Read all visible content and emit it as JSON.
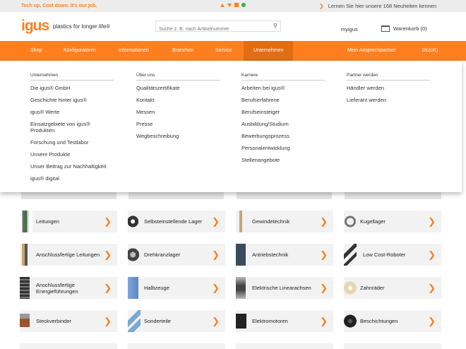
{
  "topbar": {
    "slogan": "Tech up, Cost down. It's our job.",
    "news_text": "Lernen Sie hier unsere 168 Neuheiten kennen",
    "colors": {
      "accent": "#ff7f1e",
      "green": "#2eb34a"
    }
  },
  "header": {
    "logo": "igus",
    "tagline": "plastics for longer life®",
    "search_placeholder": "Suche z. B. nach Artikelnummer",
    "myigus": "myigus",
    "cart": "Warenkorb (0)"
  },
  "nav": {
    "items": [
      "Shop",
      "Konfiguratoren",
      "Informationen",
      "Branchen",
      "Service",
      "Unternehmen"
    ],
    "contact": "Mein Ansprechpartner",
    "lang": "DE(DE)"
  },
  "dropdown": {
    "columns": [
      {
        "heading": "Unternehmen",
        "items": [
          "Die igus® GmbH",
          "Geschichte hinter igus®",
          "igus® Werte",
          "Einsatzgebiete von igus® Produkten",
          "Forschung und Testlabor",
          "Unsere Produkte",
          "Unser Beitrag zur Nachhaltigkeit",
          "igus® digital"
        ]
      },
      {
        "heading": "Über uns",
        "items": [
          "Qualitätszertifikate",
          "Kontakt",
          "Messen",
          "Presse",
          "Wegbeschreibung"
        ]
      },
      {
        "heading": "Karriere",
        "items": [
          "Arbeiten bei igus®",
          "Berufserfahrene",
          "Berufseinsteiger",
          "Ausbildung/Studium",
          "Bewerbungsprozess",
          "Personalentwicklung",
          "Stellenangebote"
        ]
      },
      {
        "heading": "Partner werden",
        "items": [
          "Händler werden",
          "Lieferant werden"
        ]
      }
    ]
  },
  "products": {
    "rows": [
      [
        "Leitungen",
        "Selbsteinstellende Lager",
        "Gewindetechnik",
        "Kugellager"
      ],
      [
        "Anschlussfertige Leitungen",
        "Drehkranzlager",
        "Antriebstechnik",
        "Low Cost-Roboter"
      ],
      [
        "Anschlussfertige Energieführungen",
        "Halbzeuge",
        "Elektrische Linearachsen",
        "Zahnräder"
      ],
      [
        "Steckverbinder",
        "Sonderteile",
        "Elektromotoren",
        "Beschichtungen"
      ]
    ]
  }
}
